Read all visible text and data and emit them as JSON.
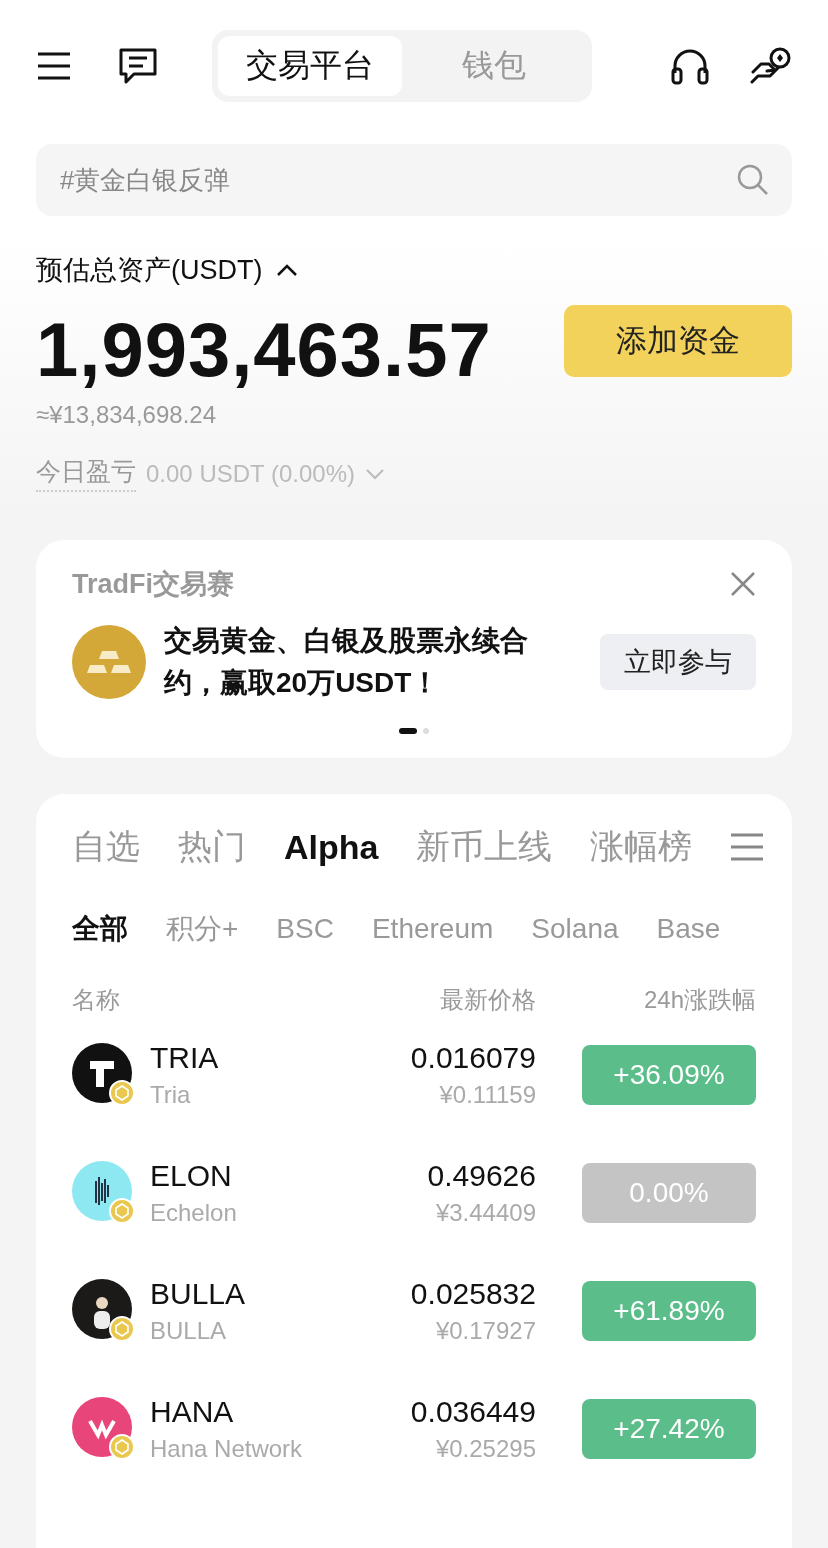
{
  "header": {
    "tabs": [
      {
        "label": "交易平台",
        "selected": true
      },
      {
        "label": "钱包",
        "selected": false
      }
    ]
  },
  "search": {
    "placeholder": "#黄金白银反弹"
  },
  "assets": {
    "label": "预估总资产(USDT)",
    "expanded": true,
    "total": "1,993,463.57",
    "fiat": "≈¥13,834,698.24",
    "pnl_label": "今日盈亏",
    "pnl_value": "0.00 USDT (0.00%)",
    "add_funds_button": "添加资金"
  },
  "banner": {
    "title": "TradFi交易赛",
    "message": "交易黄金、白银及股票永续合约，赢取20万USDT！",
    "button": "立即参与",
    "pages": [
      {
        "selected": true
      },
      {
        "selected": false
      }
    ]
  },
  "market": {
    "tabs": [
      {
        "label": "自选",
        "selected": false
      },
      {
        "label": "热门",
        "selected": false
      },
      {
        "label": "Alpha",
        "selected": true
      },
      {
        "label": "新币上线",
        "selected": false
      },
      {
        "label": "涨幅榜",
        "selected": false
      }
    ],
    "chains": [
      {
        "label": "全部",
        "selected": true
      },
      {
        "label": "积分+",
        "selected": false
      },
      {
        "label": "BSC",
        "selected": false
      },
      {
        "label": "Ethereum",
        "selected": false
      },
      {
        "label": "Solana",
        "selected": false
      },
      {
        "label": "Base",
        "selected": false
      }
    ],
    "columns": [
      "名称",
      "最新价格",
      "24h涨跌幅"
    ],
    "rows": [
      {
        "symbol": "TRIA",
        "name": "Tria",
        "price": "0.016079",
        "fiat_price": "¥0.11159",
        "change": "+36.09%",
        "rising": true,
        "color": "#111111"
      },
      {
        "symbol": "ELON",
        "name": "Echelon",
        "price": "0.49626",
        "fiat_price": "¥3.44409",
        "change": "0.00%",
        "rising": false,
        "color": "#8ee8f2"
      },
      {
        "symbol": "BULLA",
        "name": "BULLA",
        "price": "0.025832",
        "fiat_price": "¥0.17927",
        "change": "+61.89%",
        "rising": true,
        "color": "#1c1a18"
      },
      {
        "symbol": "HANA",
        "name": "Hana Network",
        "price": "0.036449",
        "fiat_price": "¥0.25295",
        "change": "+27.42%",
        "rising": true,
        "color": "#e8457a"
      }
    ]
  }
}
